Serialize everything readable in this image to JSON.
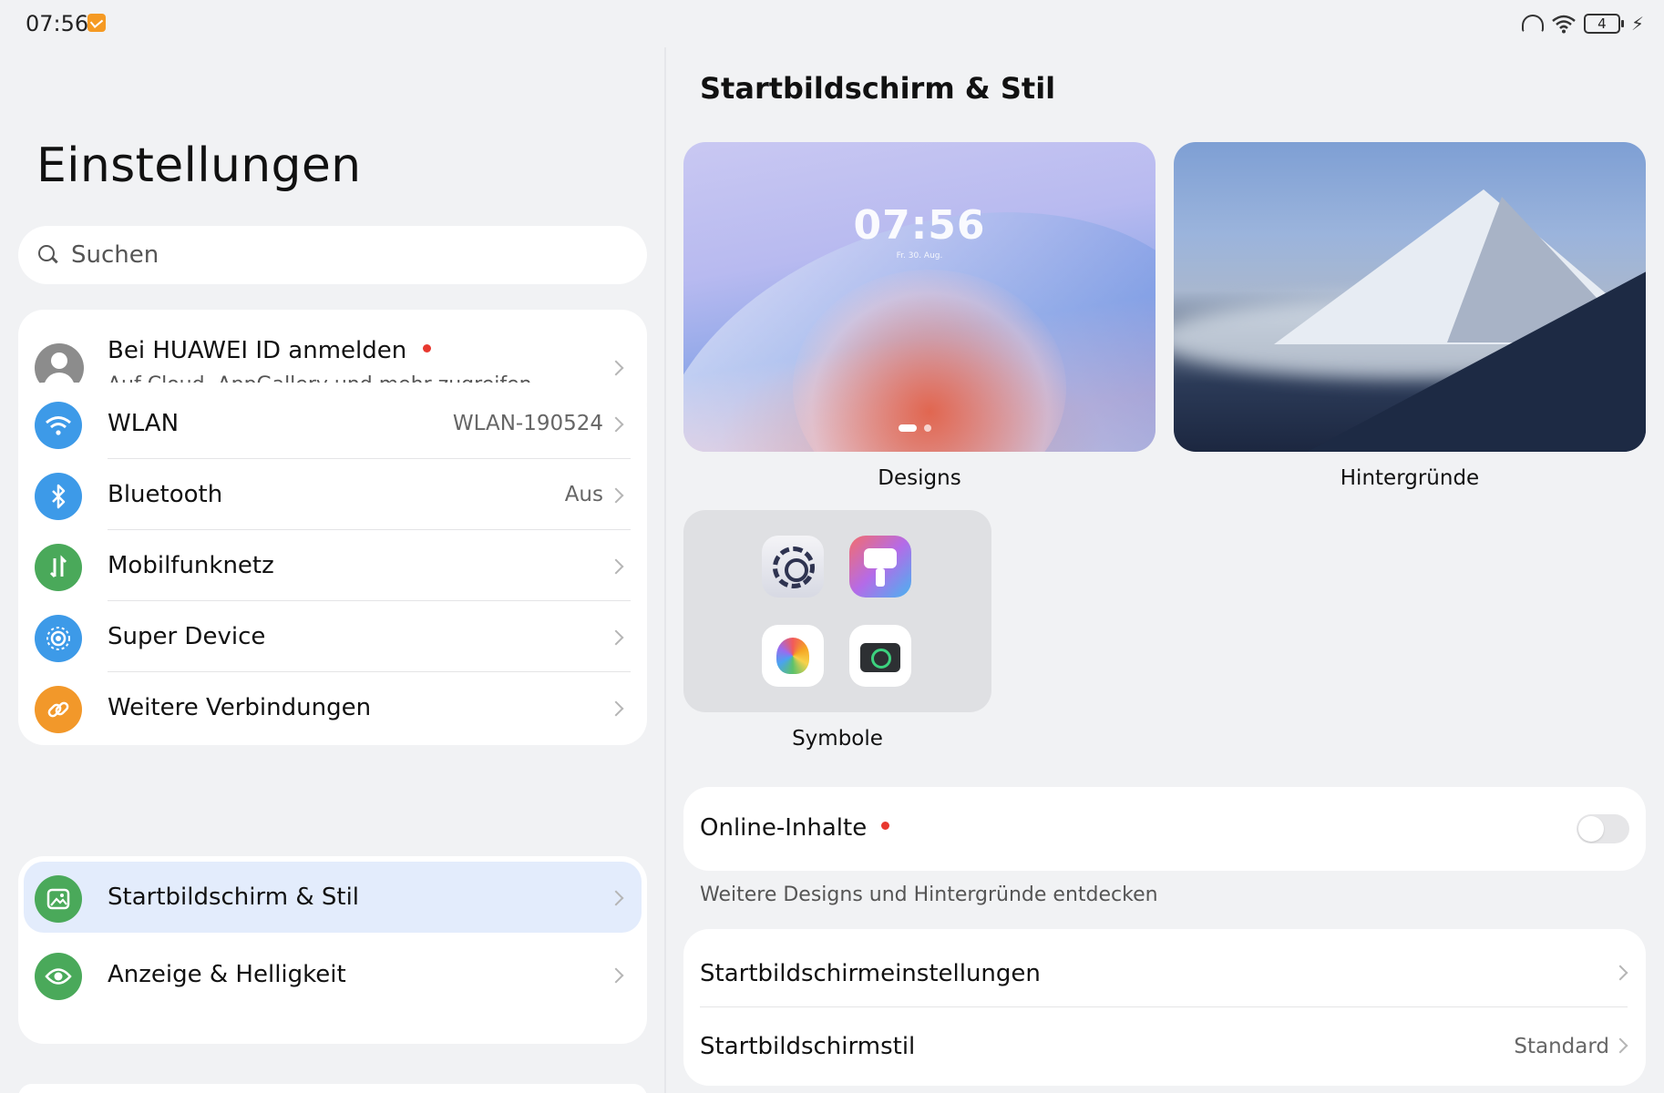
{
  "status_bar": {
    "time": "07:56",
    "battery": "4"
  },
  "left": {
    "title": "Einstellungen",
    "search": {
      "placeholder": "Suchen"
    },
    "account": {
      "title": "Bei HUAWEI ID anmelden",
      "subtitle": "Auf Cloud, AppGallery und mehr zugreifen"
    },
    "connectivity": [
      {
        "label": "WLAN",
        "value": "WLAN-190524",
        "icon": "wifi-icon",
        "color": "#3d9ae8"
      },
      {
        "label": "Bluetooth",
        "value": "Aus",
        "icon": "bluetooth-icon",
        "color": "#3d9ae8"
      },
      {
        "label": "Mobilfunknetz",
        "value": "",
        "icon": "mobile-data-icon",
        "color": "#4aa95a"
      },
      {
        "label": "Super Device",
        "value": "",
        "icon": "super-device-icon",
        "color": "#3d9ae8"
      },
      {
        "label": "Weitere Verbindungen",
        "value": "",
        "icon": "link-icon",
        "color": "#f2982a"
      }
    ],
    "display": [
      {
        "label": "Startbildschirm & Stil",
        "icon": "image-icon",
        "color": "#4aa95a",
        "selected": true
      },
      {
        "label": "Anzeige & Helligkeit",
        "icon": "eye-icon",
        "color": "#4aa95a",
        "selected": false
      }
    ]
  },
  "right": {
    "title": "Startbildschirm & Stil",
    "designs": {
      "label": "Designs",
      "preview_time": "07:56",
      "preview_date": "Fr. 30. Aug."
    },
    "wallpapers": {
      "label": "Hintergründe"
    },
    "icons": {
      "label": "Symbole"
    },
    "online": {
      "label": "Online-Inhalte",
      "enabled": false,
      "hint": "Weitere Designs und Hintergründe entdecken"
    },
    "settings": [
      {
        "label": "Startbildschirmeinstellungen",
        "value": ""
      },
      {
        "label": "Startbildschirmstil",
        "value": "Standard"
      }
    ]
  }
}
